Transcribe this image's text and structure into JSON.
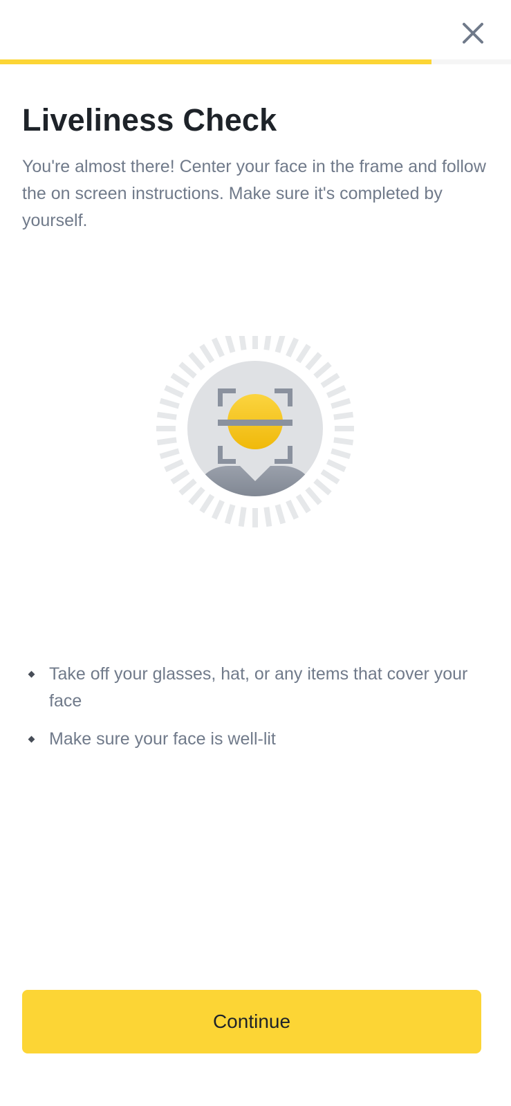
{
  "header": {
    "close_icon": "close-icon",
    "progress_fraction": 0.845
  },
  "page": {
    "title": "Liveliness Check",
    "subtitle": "You're almost there! Center your face in the frame and follow the on screen instructions. Make sure it's completed by yourself."
  },
  "illustration": {
    "icon": "face-scan-icon",
    "colors": {
      "accent": "#fcd535",
      "frame": "#8a919e",
      "circle": "#dfe1e4",
      "ticks": "#e6e8ea"
    }
  },
  "tips": [
    {
      "text": "Take off your glasses, hat, or any items that cover your face"
    },
    {
      "text": "Make sure your face is well-lit"
    }
  ],
  "footer": {
    "continue_label": "Continue"
  },
  "colors": {
    "brand_yellow": "#fcd535",
    "text_primary": "#1e2329",
    "text_secondary": "#707a8a"
  }
}
